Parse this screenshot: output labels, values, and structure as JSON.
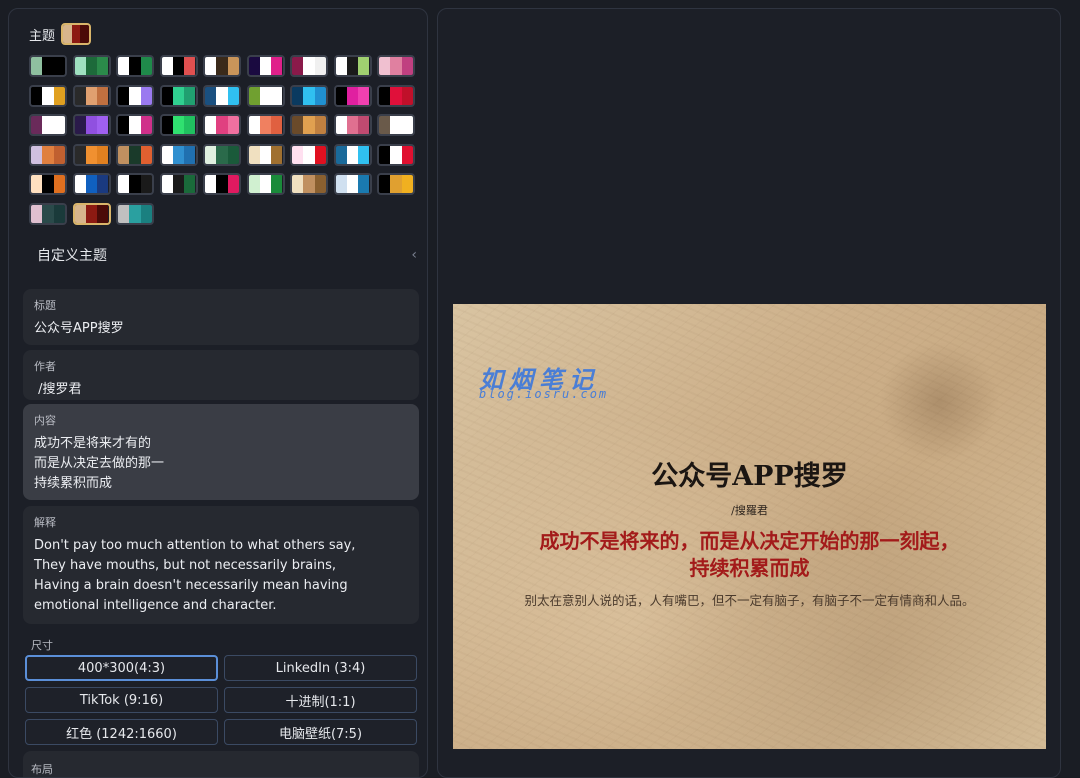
{
  "theme": {
    "label": "主题",
    "current": [
      "#d7b58c",
      "#8c1a12",
      "#4b0b08"
    ],
    "swatches": [
      [
        "#8fc0a0",
        "#000000",
        "#000000"
      ],
      [
        "#9fe0c0",
        "#1d6a3a",
        "#2b8a4a"
      ],
      [
        "#ffffff",
        "#000000",
        "#1f8a4a"
      ],
      [
        "#ffffff",
        "#000000",
        "#e05050"
      ],
      [
        "#ffffff",
        "#3a2a1a",
        "#c9955a"
      ],
      [
        "#1a0a40",
        "#ffffff",
        "#e0208a"
      ],
      [
        "#8a1a4a",
        "#ffffff",
        "#f0f0f0"
      ],
      [
        "#ffffff",
        "#1a1a1a",
        "#a0d070"
      ],
      [
        "#f0c0d0",
        "#e080a0",
        "#c04080"
      ],
      [
        "#000000",
        "#ffffff",
        "#e0a020"
      ],
      [
        "#2a2a2a",
        "#e0a070",
        "#c07040"
      ],
      [
        "#000000",
        "#ffffff",
        "#9a7af0"
      ],
      [
        "#000000",
        "#30d090",
        "#20a070"
      ],
      [
        "#1a5080",
        "#ffffff",
        "#30c0f0"
      ],
      [
        "#70a030",
        "#ffffff",
        "#ffffff"
      ],
      [
        "#0a3a60",
        "#30c0f0",
        "#2090d0"
      ],
      [
        "#000000",
        "#e020a0",
        "#f040b0"
      ],
      [
        "#000000",
        "#e0103a",
        "#c0102a"
      ],
      [
        "#6a2a5a",
        "#ffffff",
        "#ffffff"
      ],
      [
        "#2a1a4a",
        "#9050e0",
        "#a060f0"
      ],
      [
        "#000000",
        "#ffffff",
        "#d0308a"
      ],
      [
        "#000000",
        "#30e070",
        "#20c060"
      ],
      [
        "#ffffff",
        "#e04080",
        "#f070a0"
      ],
      [
        "#ffffff",
        "#f08060",
        "#e06040"
      ],
      [
        "#6a4a2a",
        "#e0a050",
        "#c08040"
      ],
      [
        "#ffffff",
        "#e07090",
        "#c04a70"
      ],
      [
        "#6a5a4a",
        "#ffffff",
        "#ffffff"
      ],
      [
        "#d0c0e0",
        "#e08040",
        "#c06030"
      ],
      [
        "#2a2a2a",
        "#f09030",
        "#e08020"
      ],
      [
        "#c09060",
        "#1a3a2a",
        "#e06030"
      ],
      [
        "#ffffff",
        "#3090d0",
        "#2070b0"
      ],
      [
        "#e0f0e0",
        "#2a6a4a",
        "#1a5a3a"
      ],
      [
        "#f0e0c0",
        "#ffffff",
        "#a07030"
      ],
      [
        "#ffe0f0",
        "#ffffff",
        "#e01020"
      ],
      [
        "#1a6a9a",
        "#ffffff",
        "#30c0f0"
      ],
      [
        "#000000",
        "#ffffff",
        "#e01030"
      ],
      [
        "#ffe0c0",
        "#000000",
        "#e07020"
      ],
      [
        "#ffffff",
        "#1060c0",
        "#1a3a80"
      ],
      [
        "#ffffff",
        "#000000",
        "#1a1a1a"
      ],
      [
        "#ffffff",
        "#1a1a1a",
        "#1a6a3a"
      ],
      [
        "#ffffff",
        "#000000",
        "#e01a60"
      ],
      [
        "#d0f0d0",
        "#ffffff",
        "#1a8a3a"
      ],
      [
        "#f0e0c0",
        "#c09060",
        "#8a6030"
      ],
      [
        "#d0e0f0",
        "#ffffff",
        "#1a7ab0"
      ],
      [
        "#000000",
        "#e0a030",
        "#f0b020"
      ],
      [
        "#e0c0d0",
        "#2a4a4a",
        "#1a3a3a"
      ],
      [
        "#d7b58c",
        "#8c1a12",
        "#4b0b08"
      ],
      [
        "#c0c0c0",
        "#2aa0a0",
        "#1a8080"
      ]
    ],
    "selected_index": 46
  },
  "custom_theme": {
    "label": "自定义主题",
    "chevron": "‹"
  },
  "fields": {
    "title": {
      "label": "标题",
      "value": "公众号APP搜罗"
    },
    "author": {
      "label": "作者",
      "value": " /搜罗君"
    },
    "content": {
      "label": "内容",
      "value": "成功不是将来才有的\n而是从决定去做的那一\n持续累积而成"
    },
    "explain": {
      "label": "解释",
      "value": "Don't pay too much attention to what others say,\nThey have mouths, but not necessarily brains,\nHaving a brain doesn't necessarily mean having\nemotional intelligence and character."
    }
  },
  "size": {
    "label": "尺寸",
    "options": [
      "400*300(4:3)",
      "LinkedIn (3:4)",
      "TikTok (9:16)",
      "十进制(1:1)",
      "红色 (1242:1660)",
      "电脑壁纸(7:5)"
    ],
    "selected_index": 0
  },
  "layout": {
    "label": "布局"
  },
  "card": {
    "watermark_title": "如烟笔记",
    "watermark_sub": "blog.iosru.com",
    "title": "公众号APP搜罗",
    "author": "/搜羅君",
    "content": "成功不是将来的，而是从决定开始的那一刻起，\n持续积累而成",
    "explain": "别太在意别人说的话，人有嘴巴，但不一定有脑子，有脑子不一定有情商和人品。"
  }
}
